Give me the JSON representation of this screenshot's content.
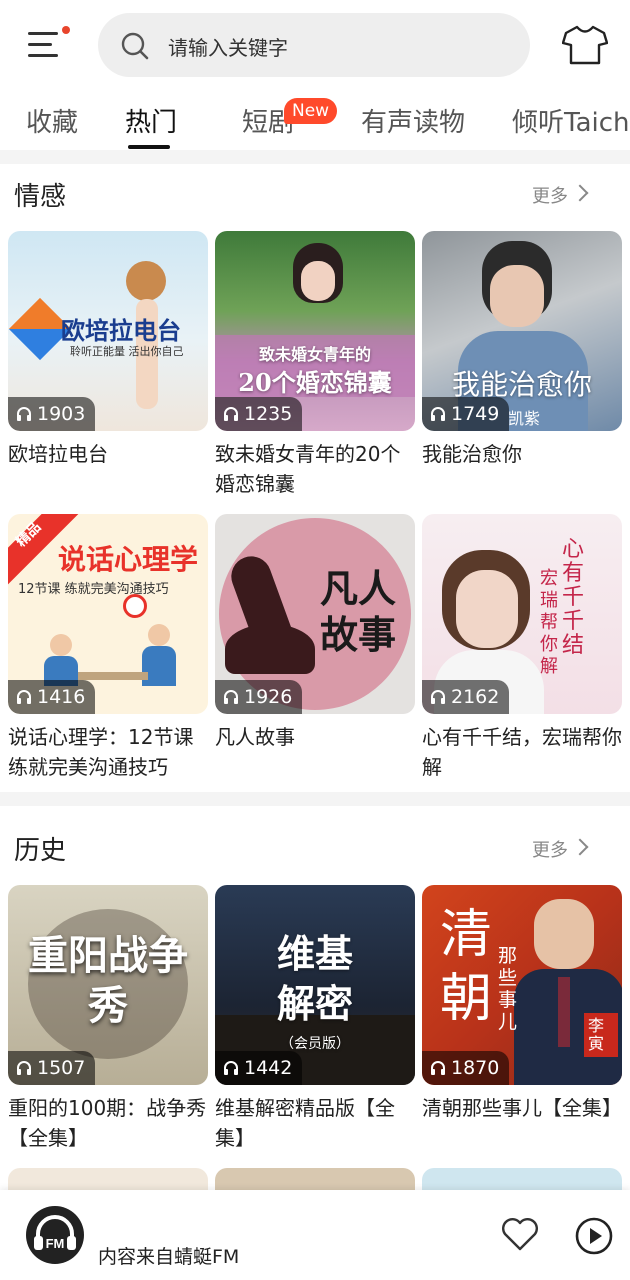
{
  "search": {
    "placeholder": "请输入关键字"
  },
  "tabs": [
    {
      "label": "收藏"
    },
    {
      "label": "热门"
    },
    {
      "label": "短剧",
      "badge": "New"
    },
    {
      "label": "有声读物"
    },
    {
      "label": "倾听Taichu"
    }
  ],
  "more_label": "更多",
  "sections": [
    {
      "title": "情感",
      "cards": [
        {
          "title": "欧培拉电台",
          "plays": "1903",
          "cover_text": "欧培拉电台",
          "cover_sub": "聆听正能量  活出你自己"
        },
        {
          "title": "致未婚女青年的20个婚恋锦囊",
          "plays": "1235",
          "cover_text": "20个婚恋锦囊",
          "cover_sub": "致未婚女青年的"
        },
        {
          "title": "我能治愈你",
          "plays": "1749",
          "cover_text": "我能治愈你",
          "cover_sub": "凯紫"
        },
        {
          "title": "说话心理学：12节课练就完美沟通技巧",
          "plays": "1416",
          "cover_text": "说话心理学",
          "cover_sub": "12节课 练就完美沟通技巧",
          "badge": "精品"
        },
        {
          "title": "凡人故事",
          "plays": "1926",
          "cover_text": "凡人故事"
        },
        {
          "title": "心有千千结，宏瑞帮你解",
          "plays": "2162",
          "cover_text": "心有千千结",
          "cover_sub": "宏瑞帮你解"
        }
      ]
    },
    {
      "title": "历史",
      "cards": [
        {
          "title": "重阳的100期：战争秀【全集】",
          "plays": "1507",
          "cover_text": "重阳战争秀"
        },
        {
          "title": "维基解密精品版【全集】",
          "plays": "1442",
          "cover_text": "维基解密",
          "cover_sub": "（会员版）"
        },
        {
          "title": "清朝那些事儿【全集】",
          "plays": "1870",
          "cover_text": "清朝",
          "cover_sub": "那些事儿",
          "cover_tag": "李寅"
        }
      ]
    }
  ],
  "player": {
    "source_text": "内容来自蜻蜓FM",
    "logo_text": "FM"
  },
  "colors": {
    "accent": "#ff4a2b",
    "badge_new": "#ff4a2b"
  },
  "icons": [
    "menu-icon",
    "search-icon",
    "shirt-icon",
    "headphones-icon",
    "chevron-right-icon",
    "heart-icon",
    "play-icon"
  ]
}
